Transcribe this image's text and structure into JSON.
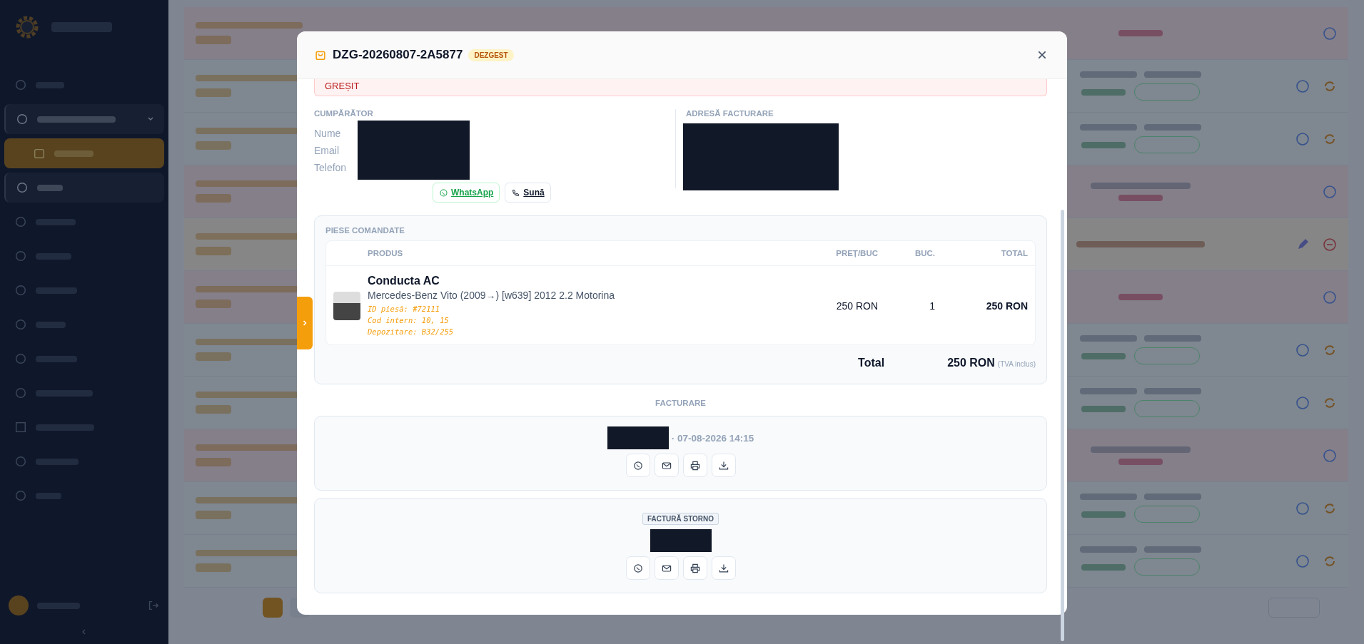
{
  "sidebar": {
    "items": [
      {
        "selected": false
      },
      {
        "selected": true,
        "expanded": true,
        "children": [
          {
            "selected": true
          }
        ]
      },
      {
        "selected": true
      },
      {
        "selected": false
      },
      {
        "selected": false
      },
      {
        "selected": false
      },
      {
        "selected": false
      },
      {
        "selected": false
      },
      {
        "selected": false
      },
      {
        "selected": false
      },
      {
        "selected": false
      },
      {
        "selected": false
      }
    ]
  },
  "orders": {
    "rows": [
      {
        "kind": "cancelled"
      },
      {
        "kind": "shipped"
      },
      {
        "kind": "shipped"
      },
      {
        "kind": "cancelled_storno"
      },
      {
        "kind": "awaiting"
      },
      {
        "kind": "cancelled"
      },
      {
        "kind": "shipped"
      },
      {
        "kind": "shipped"
      },
      {
        "kind": "cancelled_storno"
      },
      {
        "kind": "shipped"
      },
      {
        "kind": "shipped"
      }
    ],
    "pagination": {
      "pages": [
        {
          "selected": true
        },
        {
          "selected": false
        }
      ]
    }
  },
  "modal": {
    "title": "DZG-20260807-2A5877",
    "badge": "DEZGEST",
    "alert": "GREȘIT",
    "buyer": {
      "heading": "CUMPĂRĂTOR",
      "fields": [
        "Nume",
        "Email",
        "Telefon"
      ],
      "actions": [
        {
          "kind": "whatsapp",
          "label": "WhatsApp"
        },
        {
          "kind": "call",
          "label": "Sună"
        }
      ]
    },
    "billing_address": {
      "heading": "ADRESĂ FACTURARE"
    },
    "items": {
      "heading": "PIESE COMANDATE",
      "columns": [
        "PRODUS",
        "PREȚ/BUC",
        "BUC.",
        "TOTAL"
      ],
      "rows": [
        {
          "name": "Conducta AC",
          "vehicle": "Mercedes-Benz Vito (2009→) [w639] 2012 2.2 Motorina",
          "details": [
            "ID piesă: #72111",
            "Cod intern: 10, 15",
            "Depozitare: B32/255"
          ],
          "price": "250 RON",
          "qty": "1",
          "total": "250 RON"
        }
      ],
      "total_label": "Total",
      "total": "250 RON",
      "total_note": "(TVA inclus)"
    },
    "invoicing": {
      "heading": "FACTURARE",
      "invoices": [
        {
          "kind": "invoice",
          "date": "· 07-08-2026 14:15"
        },
        {
          "kind": "storno",
          "tag": "FACTURĂ STORNO"
        }
      ]
    }
  }
}
